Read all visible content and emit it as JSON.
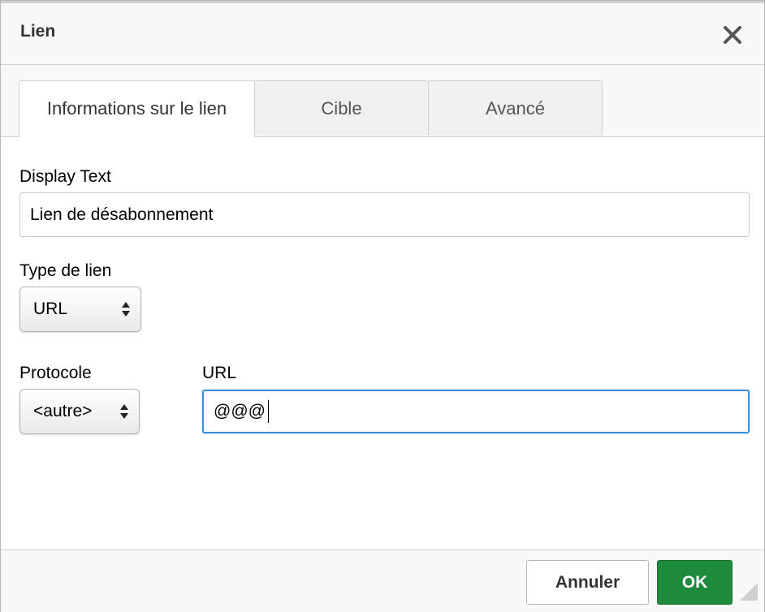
{
  "dialog": {
    "title": "Lien",
    "close_icon": "close-icon"
  },
  "tabs": [
    {
      "label": "Informations sur le lien",
      "active": true
    },
    {
      "label": "Cible",
      "active": false
    },
    {
      "label": "Avancé",
      "active": false
    }
  ],
  "form": {
    "display_text_label": "Display Text",
    "display_text_value": "Lien de désabonnement",
    "link_type_label": "Type de lien",
    "link_type_value": "URL",
    "protocol_label": "Protocole",
    "protocol_value": "<autre>",
    "url_label": "URL",
    "url_value": "@@@"
  },
  "footer": {
    "cancel_label": "Annuler",
    "ok_label": "OK"
  },
  "colors": {
    "ok_button": "#1e8a3d",
    "focus_border": "#3b8fe0"
  }
}
